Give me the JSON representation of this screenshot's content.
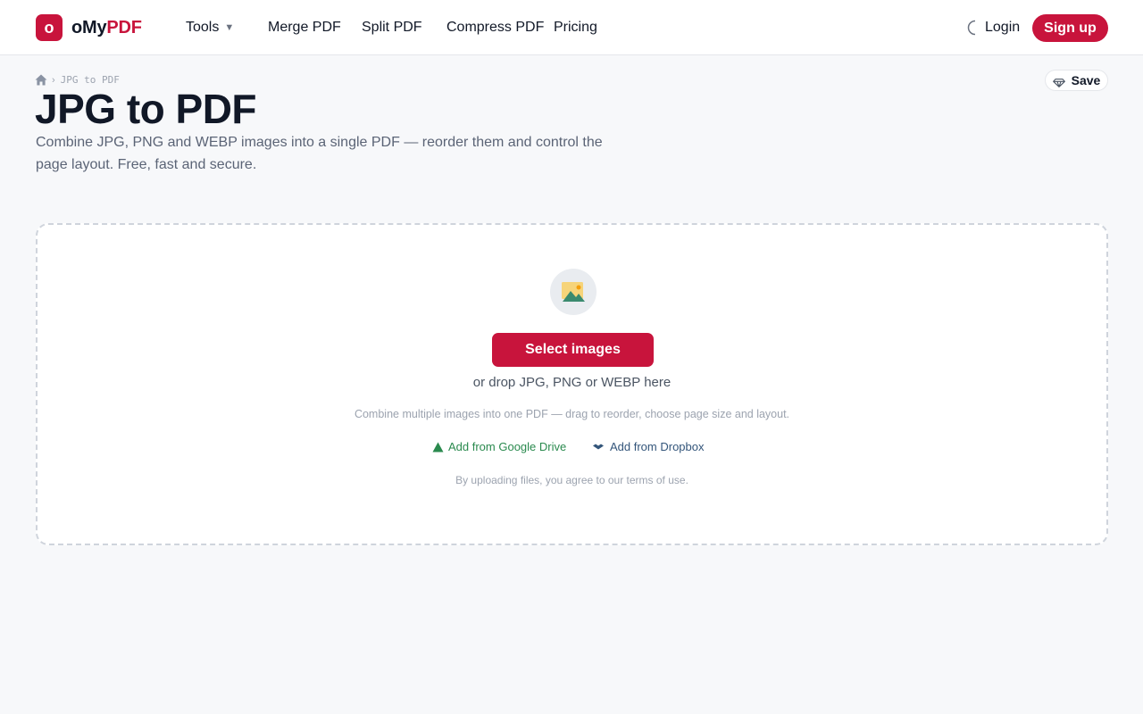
{
  "header": {
    "logo_mark": "o",
    "logo_prefix": "oMy",
    "logo_accent": "PDF",
    "nav": {
      "tools": "Tools",
      "merge": "Merge PDF",
      "split": "Split PDF",
      "compress": "Compress PDF",
      "pricing": "Pricing",
      "login": "Login"
    },
    "signup_label": "Sign up",
    "icons": {
      "tools_caret": "chevron-down-icon",
      "theme": "moon-icon"
    }
  },
  "breadcrumb": {
    "home_icon": "home-icon",
    "separator": "›",
    "current": "JPG to PDF"
  },
  "save_button": {
    "label": "Save",
    "icon": "diamond-icon"
  },
  "page": {
    "title": "JPG to PDF",
    "subtitle": "Combine JPG, PNG and WEBP images into a single PDF — reorder them and control the page layout. Free, fast and secure."
  },
  "dropzone": {
    "icon": "image-icon",
    "select_label": "Select images",
    "hint": "or drop JPG, PNG or WEBP here",
    "description": "Combine multiple images into one PDF — drag to reorder, choose page size and layout.",
    "google_drive_label": "Add from Google Drive",
    "dropbox_label": "Add from Dropbox",
    "terms": "By uploading files, you agree to our terms of use."
  },
  "colors": {
    "brand": "#c8143c",
    "page_background": "#f7f8fa",
    "google_drive": "#2a8a4e",
    "dropbox": "#33557a"
  }
}
